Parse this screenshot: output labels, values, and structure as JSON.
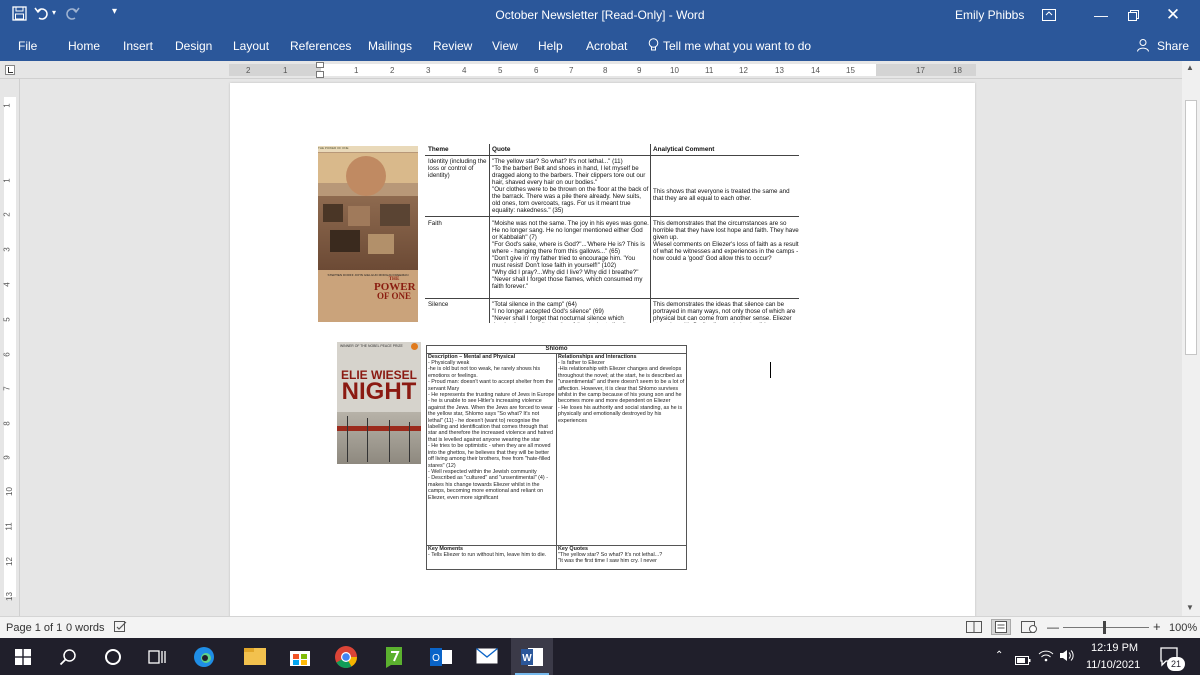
{
  "window": {
    "title": "October Newsletter [Read-Only]  -  Word",
    "user": "Emily Phibbs"
  },
  "ribbon": {
    "tabs": [
      "File",
      "Home",
      "Insert",
      "Design",
      "Layout",
      "References",
      "Mailings",
      "Review",
      "View",
      "Help",
      "Acrobat"
    ],
    "tell_me": "Tell me what you want to do",
    "share": "Share"
  },
  "ruler": {
    "h_ticks": [
      "2",
      "1",
      "1",
      "2",
      "3",
      "4",
      "5",
      "6",
      "7",
      "8",
      "9",
      "10",
      "11",
      "12",
      "13",
      "14",
      "15",
      "17",
      "18"
    ],
    "v_ticks": [
      "1",
      "1",
      "2",
      "3",
      "4",
      "5",
      "6",
      "7",
      "8",
      "9",
      "10",
      "11",
      "12",
      "13"
    ]
  },
  "table1": {
    "headers": [
      "Theme",
      "Quote",
      "Analytical Comment"
    ],
    "rows": [
      {
        "theme": "Identity (including the loss or control of identity)",
        "quote": "\"The yellow star? So what? It's not lethal...\" (11)\n\"To the barber! Belt and shoes in hand, I let myself be dragged along to the barbers. Their clippers tore out our hair, shaved every hair on our bodies.\"\n\"Our clothes were to be thrown on the floor at the back of the barrack. There was a pile there already. New suits, old ones, torn overcoats, rags. For us it meant true equality: nakedness.\" (35)",
        "comment": "This shows that everyone is treated the same and that they are all equal to each other."
      },
      {
        "theme": "Faith",
        "quote": "\"Moishe was not the same. The joy in his eyes was gone. He no longer sang. He no longer mentioned either God or Kabbalah\" (7)\n\"For God's sake, where is God?\"...'Where He is? This is where - hanging there from this gallows...\" (65)\n\"Don't give in' my father tried to encourage him. 'You must resist! Don't lose faith in yourself!\" (102)\n\"Why did I pray?...Why did I live? Why did I breathe?\"\n\"Never shall I forget those flames, which consumed my faith forever.\"",
        "comment": "This demonstrates that the circumstances are so horrible that they have lost hope and faith. They have given up.\nWiesel comments on Eliezer's loss of faith as a result of what he witnesses and experiences in the camps - how could a 'good' God allow this to occur?"
      },
      {
        "theme": "Silence",
        "quote": "\"Total silence in the camp\" (64)\n\"I no longer accepted God's silence\" (69)\n\"Never shall I forget that nocturnal silence which deprived me, for all eternity, of the desire to live.\"",
        "comment": "This demonstrates the ideas that silence can be portrayed in many ways, not only those of which are physical but can come from another sense. Eliezer struggles with God's silence during terrible"
      }
    ]
  },
  "poster": {
    "top_line": "THE POWER OF ONE",
    "cast": "STEPHEN DORFF   JOHN GIELGUD   MORGAN FREEMAN",
    "title_line1": "THE",
    "title_line2": "POWER",
    "title_line3": "OF ONE"
  },
  "book": {
    "banner": "WINNER OF THE NOBEL PEACE PRIZE",
    "author": "ELIE WIESEL",
    "title": "NIGHT"
  },
  "table2": {
    "title": "Shlomo",
    "desc_header": "Description – Mental and Physical",
    "desc_body": "- Physically weak\n-he is old but not too weak, he rarely shows his emotions or feelings.\n- Proud man: doesn't want to accept shelter from the servant Mary\n- He represents the trusting nature of Jews in Europe - he is unable to see Hitler's increasing violence against the Jews. When the Jews are forced to wear the yellow star, Shlomo says \"So what? It's not lethal\" (11) - he doesn't (want to) recognise the labelling and identification that comes through that star and therefore the increased violence and hatred that is levelled against anyone wearing the star\n- He tries to be optimistic - when they are all moved into the ghettos, he believes that they will be better off living among their brothers, free from \"hate-filled stares\" (12)\n- Well respected within the Jewish community\n- Described as \"cultured\" and \"unsentimental\" (4) - makes his change towards Eliezer whilst in the camps, becoming more emotional and reliant on Eliezer, even more significant",
    "rel_header": "Relationships and Interactions",
    "rel_body": "- Is father to Eliezer\n-His relationship with Eliezer changes and develops throughout the novel; at the start, he is described as \"unsentimental\" and there doesn't seem to be a lot of affection. However, it is clear that Shlomo survives whilst in the camp because of his young son and he becomes more and more dependent on Eliezer\n- He loses his authority and social standing, as he is physically and emotionally destroyed by his experiences",
    "moments_header": "Key Moments",
    "moments_body": "- Tells Eliezer to run without him, leave him to die.",
    "quotes_header": "Key Quotes",
    "quotes_body": "\"The yellow star? So what? It's not lethal...?\n\"It was the first time I saw him cry.  I never"
  },
  "status": {
    "page": "Page 1 of 1",
    "words": "0 words",
    "zoom": "100%"
  },
  "taskbar": {
    "time": "12:19 PM",
    "date": "11/10/2021",
    "notifications": "21"
  },
  "colors": {
    "word_blue": "#2b579a",
    "taskbar": "#201f2b"
  }
}
